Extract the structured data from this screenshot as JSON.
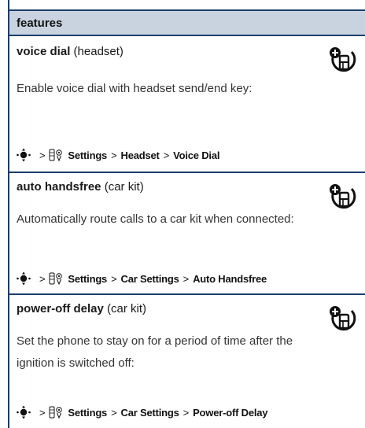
{
  "header": {
    "title": "features"
  },
  "rows": [
    {
      "name": "voice dial",
      "qualifier": " (headset)",
      "description": "Enable voice dial with headset send/end key:",
      "path": {
        "settings": "Settings",
        "step2": "Headset",
        "step3": "Voice Dial",
        "separator": ">"
      }
    },
    {
      "name": "auto handsfree",
      "qualifier": " (car kit)",
      "description": "Automatically route calls to a car kit when connected:",
      "path": {
        "settings": "Settings",
        "step2": "Car Settings",
        "step3": "Auto Handsfree",
        "separator": ">"
      }
    },
    {
      "name": "power-off delay",
      "qualifier": " (car kit)",
      "description": "Set the phone to stay on for a period of time after the ignition is switched off:",
      "path": {
        "settings": "Settings",
        "step2": "Car Settings",
        "step3": "Power-off Delay",
        "separator": ">"
      }
    }
  ],
  "icons": {
    "nav": "nav-key-icon",
    "settings": "settings-icon",
    "accessory": "accessory-icon"
  },
  "colors": {
    "header_bg": "#c9d3e0",
    "rule": "#1b3d6d"
  }
}
